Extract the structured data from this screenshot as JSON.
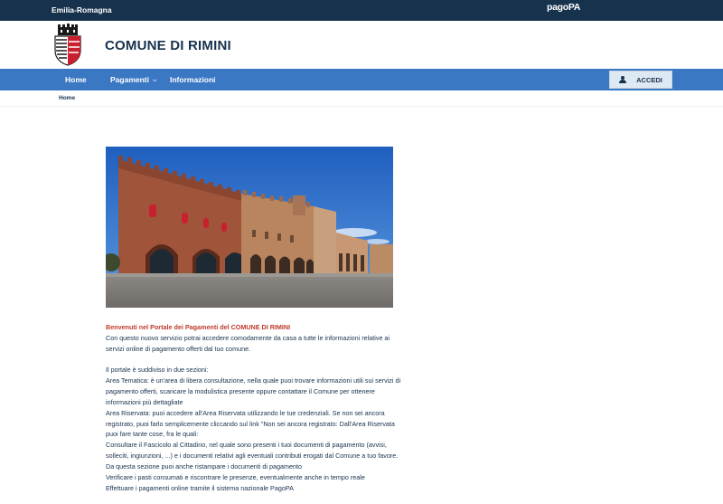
{
  "topbar": {
    "region": "Emilia-Romagna",
    "pagopa_logo": "pagoPA"
  },
  "header": {
    "title": "COMUNE DI RIMINI",
    "crest_icon": "coat-of-arms-icon"
  },
  "nav": {
    "items": [
      {
        "label": "Home"
      },
      {
        "label": "Pagamenti",
        "has_dropdown": true
      },
      {
        "label": "Informazioni"
      }
    ],
    "login_label": "ACCEDI"
  },
  "breadcrumb": {
    "current": "Home"
  },
  "hero_image": {
    "alt": "Palazzo dell'Arengo, Piazza Cavour, Rimini"
  },
  "content": {
    "intro_title": "Benvenuti nel Portale dei Pagamenti del COMUNE DI RIMINI",
    "intro_text": "Con questo nuovo servizio potrai accedere comodamente da casa a tutte le informazioni relative ai servizi online di pagamento offerti dal tuo comune.",
    "sections_intro": "Il portale è suddiviso in due sezioni:",
    "area_tematica": "Area Tematica: è un'area di libera consultazione, nella quale puoi trovare informazioni utili sui servizi di pagamento offerti, scaricare la modulistica presente oppure contattare il Comune per ottenere informazioni più dettagliate",
    "area_riservata": "Area Riservata: puoi accedere all'Area Riservata utilizzando le tue credenziali. Se non sei ancora registrato, puoi farlo semplicemente cliccando sul link \"Non sei ancora registrato: Dall'Area Riservata puoi fare tante cose, fra le quali:",
    "bullet_1": "Consultare il Fascicolo al Cittadino, nel quale sono presenti i tuoi documenti di pagamento (avvisi, solleciti, ingiunzioni, ...) e i documenti relativi agli eventuali contributi erogati dal Comune a tuo favore. Da questa sezione puoi anche ristampare i documenti di pagamento",
    "bullet_2": "Verificare i pasti consumati e riscontrare le presenze, eventualmente anche in tempo reale",
    "bullet_3": "Effettuare i pagamenti online tramite il sistema nazionale PagoPA"
  },
  "colors": {
    "topbar": "#17324d",
    "navbar": "#3a78c4",
    "accent_title": "#c0392b",
    "login_button": "#dfe9f3"
  }
}
